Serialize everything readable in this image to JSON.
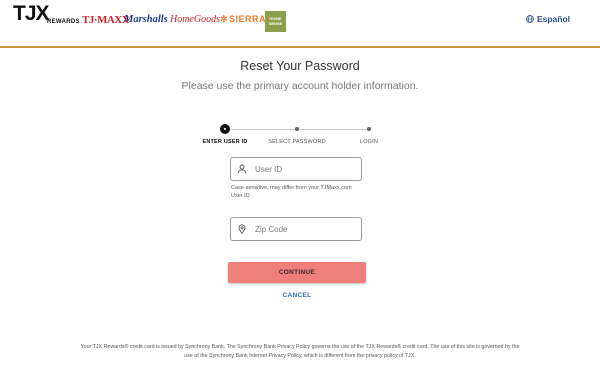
{
  "header": {
    "brands": {
      "tjx": "TJX",
      "tjx_sub": "REWARDS",
      "tjmaxx": "TJ·MAXX",
      "marshalls": "Marshalls",
      "homegoods": "HomeGoods",
      "sierra": "SIERRA",
      "homesense": "HOME SENSE"
    },
    "language_link": "Español",
    "accent_color": "#c8963c"
  },
  "main": {
    "title": "Reset Your Password",
    "subtitle": "Please use the primary account holder information."
  },
  "stepper": {
    "steps": [
      {
        "label": "ENTER USER ID",
        "state": "active"
      },
      {
        "label": "SELECT PASSWORD",
        "state": "pending"
      },
      {
        "label": "LOGIN",
        "state": "pending"
      }
    ]
  },
  "form": {
    "user_id": {
      "placeholder": "User ID",
      "value": "",
      "icon": "user-icon",
      "hint_line1": "Case-sensitive, may differ from your TJMaxx.com",
      "hint_line2": "User ID"
    },
    "zip": {
      "placeholder": "Zip Code",
      "value": "",
      "icon": "location-pin-icon"
    },
    "continue_label": "CONTINUE",
    "continue_color": "#ef7f7a",
    "cancel_label": "CANCEL"
  },
  "footer": {
    "line1": "Your TJX Rewards® credit card is issued by Synchrony Bank. The Synchrony Bank Privacy Policy governs the use of the TJX Rewards® credit card. The use of this site is governed by the",
    "line2": "use of the Synchrony Bank Internet Privacy Policy, which is different from the privacy policy of TJX."
  }
}
